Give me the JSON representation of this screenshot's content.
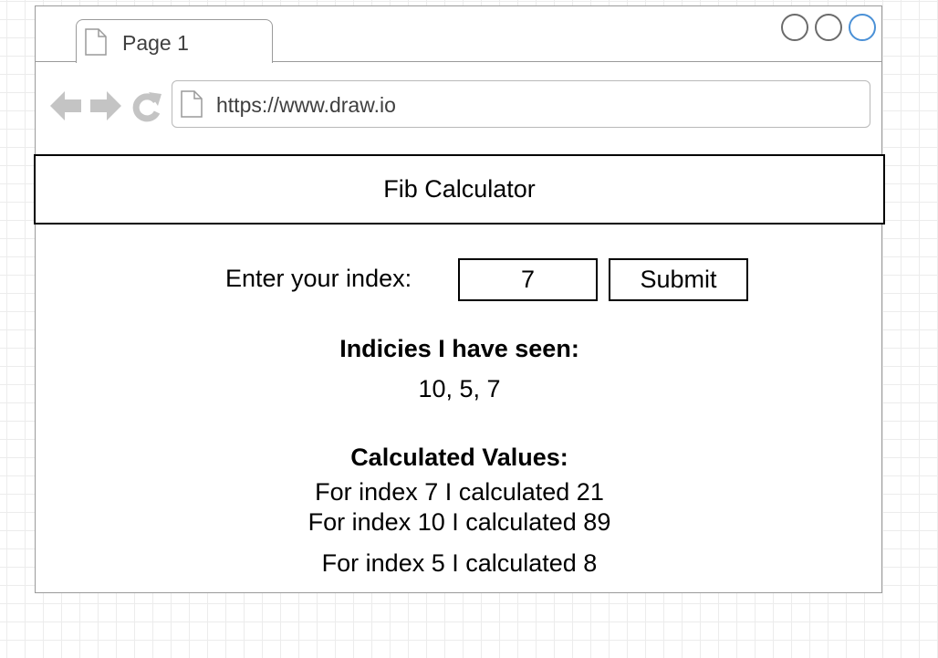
{
  "browser": {
    "tab_title": "Page 1",
    "url": "https://www.draw.io",
    "icons": {
      "back": "arrow-left-icon",
      "forward": "arrow-right-icon",
      "reload": "reload-icon",
      "page": "page-icon"
    }
  },
  "app": {
    "title": "Fib Calculator",
    "form": {
      "label": "Enter your index:",
      "input_value": "7",
      "submit_label": "Submit"
    },
    "seen": {
      "heading": "Indicies I have seen:",
      "values": "10, 5, 7"
    },
    "calculated": {
      "heading": "Calculated Values:",
      "items": [
        "For index 7 I calculated 21",
        "For index 10 I calculated 89",
        "For index 5 I calculated 8"
      ]
    }
  },
  "colors": {
    "border": "#000000",
    "chrome_border": "#9a9a9a",
    "accent_circle": "#4a90d6",
    "nav_icon": "#c4c4c4"
  }
}
